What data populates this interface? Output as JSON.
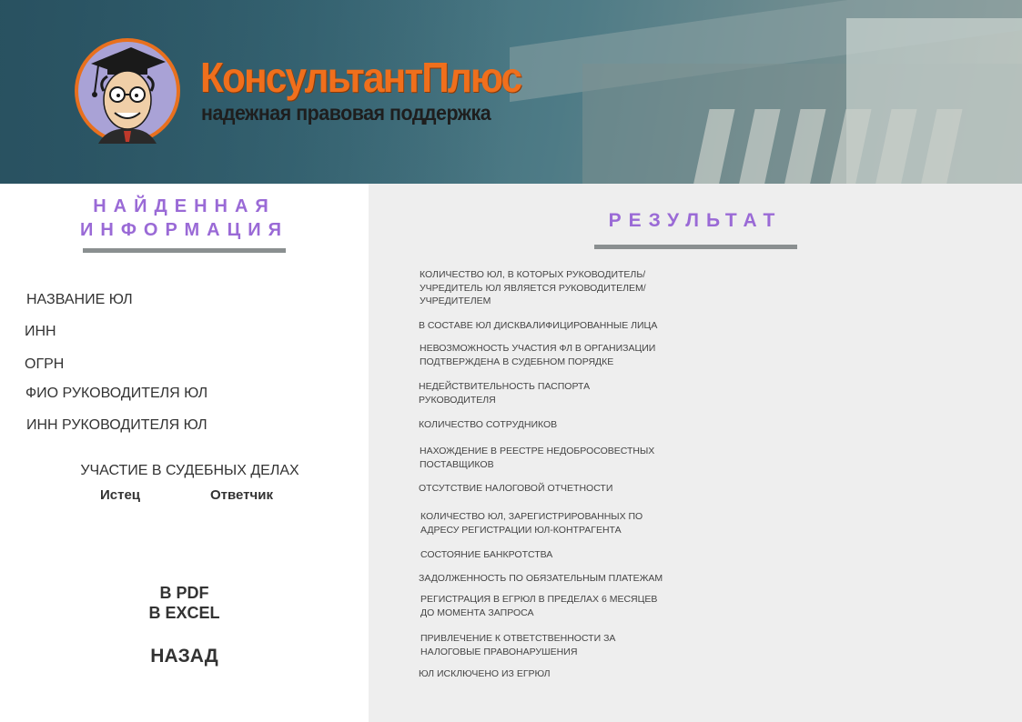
{
  "brand": {
    "name": "КонсультантПлюс",
    "tagline": "надежная правовая поддержка"
  },
  "left_panel": {
    "heading_line1": "НАЙДЕННАЯ",
    "heading_line2": "ИНФОРМАЦИЯ",
    "fields": [
      "НАЗВАНИЕ ЮЛ",
      "ИНН",
      "ОГРН",
      "ФИО РУКОВОДИТЕЛЯ ЮЛ",
      "ИНН РУКОВОДИТЕЛЯ ЮЛ"
    ],
    "court": {
      "title": "УЧАСТИЕ В СУДЕБНЫХ ДЕЛАХ",
      "plaintiff": "Истец",
      "defendant": "Ответчик"
    },
    "actions": {
      "pdf": "В PDF",
      "excel": "В EXCEL",
      "back": "НАЗАД"
    }
  },
  "right_panel": {
    "heading": "РЕЗУЛЬТАТ",
    "items": [
      "КОЛИЧЕСТВО ЮЛ, В КОТОРЫХ РУКОВОДИТЕЛЬ/ УЧРЕДИТЕЛЬ ЮЛ ЯВЛЯЕТСЯ РУКОВОДИТЕЛЕМ/ УЧРЕДИТЕЛЕМ",
      "В СОСТАВЕ ЮЛ ДИСКВАЛИФИЦИРОВАННЫЕ ЛИЦА",
      "НЕВОЗМОЖНОСТЬ УЧАСТИЯ ФЛ В ОРГАНИЗАЦИИ ПОДТВЕРЖДЕНА В СУДЕБНОМ ПОРЯДКЕ",
      "НЕДЕЙСТВИТЕЛЬНОСТЬ ПАСПОРТА РУКОВОДИТЕЛЯ",
      "КОЛИЧЕСТВО СОТРУДНИКОВ",
      "НАХОЖДЕНИЕ В РЕЕСТРЕ НЕДОБРОСОВЕСТНЫХ ПОСТАВЩИКОВ",
      "ОТСУТСТВИЕ НАЛОГОВОЙ ОТЧЕТНОСТИ",
      "КОЛИЧЕСТВО ЮЛ, ЗАРЕГИСТРИРОВАННЫХ ПО АДРЕСУ РЕГИСТРАЦИИ ЮЛ-КОНТРАГЕНТА",
      "СОСТОЯНИЕ БАНКРОТСТВА",
      "ЗАДОЛЖЕННОСТЬ ПО ОБЯЗАТЕЛЬНЫМ ПЛАТЕЖАМ",
      "РЕГИСТРАЦИЯ В ЕГРЮЛ В ПРЕДЕЛАХ 6 МЕСЯЦЕВ ДО МОМЕНТА ЗАПРОСА",
      "ПРИВЛЕЧЕНИЕ К ОТВЕТСТВЕННОСТИ ЗА НАЛОГОВЫЕ ПРАВОНАРУШЕНИЯ",
      "ЮЛ ИСКЛЮЧЕНО ИЗ ЕГРЮЛ"
    ]
  },
  "colors": {
    "accent_purple": "#9a6ad6",
    "brand_orange": "#f06f1c",
    "divider_gray": "#8a8f90",
    "right_panel_bg": "#eeeeee"
  }
}
